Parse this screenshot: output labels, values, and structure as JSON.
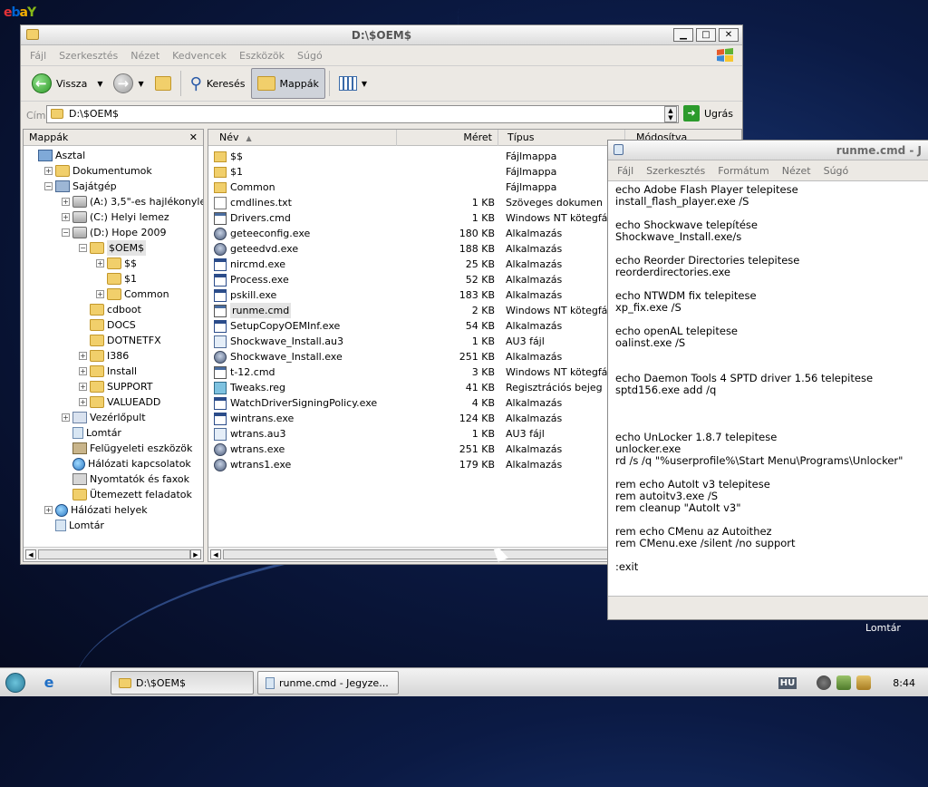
{
  "desktop": {
    "logo_letters": [
      "e",
      "b",
      "a",
      "Y"
    ],
    "icon_label": "Lomtár"
  },
  "explorer": {
    "title": "D:\\$OEM$",
    "menu": [
      "Fájl",
      "Szerkesztés",
      "Nézet",
      "Kedvencek",
      "Eszközök",
      "Súgó"
    ],
    "toolbar": {
      "back": "Vissza",
      "search": "Keresés",
      "folders": "Mappák"
    },
    "address": {
      "label": "Cím",
      "value": "D:\\$OEM$",
      "go": "Ugrás"
    },
    "folders_pane": {
      "title": "Mappák",
      "tree": [
        {
          "label": "Asztal",
          "icon": "desktop-icon",
          "level": 0,
          "expander": ""
        },
        {
          "label": "Dokumentumok",
          "icon": "folder-icon",
          "level": 1,
          "expander": "+"
        },
        {
          "label": "Sajátgép",
          "icon": "computer-icon",
          "level": 1,
          "expander": "-"
        },
        {
          "label": "(A:) 3,5\"-es hajlékonyle",
          "icon": "floppy-icon",
          "level": 2,
          "expander": "+"
        },
        {
          "label": "(C:) Helyi lemez",
          "icon": "drive-icon",
          "level": 2,
          "expander": "+"
        },
        {
          "label": "(D:) Hope 2009",
          "icon": "cd-drive-icon",
          "level": 2,
          "expander": "-"
        },
        {
          "label": "$OEM$",
          "icon": "folder-open-icon",
          "level": 3,
          "expander": "-",
          "selected": true
        },
        {
          "label": "$$",
          "icon": "folder-icon",
          "level": 4,
          "expander": "+"
        },
        {
          "label": "$1",
          "icon": "folder-icon",
          "level": 4,
          "expander": ""
        },
        {
          "label": "Common",
          "icon": "folder-icon",
          "level": 4,
          "expander": "+"
        },
        {
          "label": "cdboot",
          "icon": "folder-icon",
          "level": 3,
          "expander": ""
        },
        {
          "label": "DOCS",
          "icon": "folder-icon",
          "level": 3,
          "expander": ""
        },
        {
          "label": "DOTNETFX",
          "icon": "folder-icon",
          "level": 3,
          "expander": ""
        },
        {
          "label": "I386",
          "icon": "folder-icon",
          "level": 3,
          "expander": "+"
        },
        {
          "label": "Install",
          "icon": "folder-icon",
          "level": 3,
          "expander": "+"
        },
        {
          "label": "SUPPORT",
          "icon": "folder-icon",
          "level": 3,
          "expander": "+"
        },
        {
          "label": "VALUEADD",
          "icon": "folder-icon",
          "level": 3,
          "expander": "+"
        },
        {
          "label": "Vezérlőpult",
          "icon": "control-panel-icon",
          "level": 2,
          "expander": "+"
        },
        {
          "label": "Lomtár",
          "icon": "recycle-bin-icon",
          "level": 2,
          "expander": ""
        },
        {
          "label": "Felügyeleti eszközök",
          "icon": "tools-icon",
          "level": 2,
          "expander": ""
        },
        {
          "label": "Hálózati kapcsolatok",
          "icon": "network-icon",
          "level": 2,
          "expander": ""
        },
        {
          "label": "Nyomtatók és faxok",
          "icon": "printer-icon",
          "level": 2,
          "expander": ""
        },
        {
          "label": "Ütemezett feladatok",
          "icon": "folder-icon",
          "level": 2,
          "expander": ""
        },
        {
          "label": "Hálózati helyek",
          "icon": "network-icon",
          "level": 1,
          "expander": "+"
        },
        {
          "label": "Lomtár",
          "icon": "recycle-bin-icon",
          "level": 1,
          "expander": ""
        }
      ]
    },
    "file_list": {
      "columns": [
        "Név",
        "Méret",
        "Típus",
        "Módosítva"
      ],
      "rows": [
        {
          "name": "$$",
          "size": "",
          "type": "Fájlmappa",
          "icon": "folder"
        },
        {
          "name": "$1",
          "size": "",
          "type": "Fájlmappa",
          "icon": "folder"
        },
        {
          "name": "Common",
          "size": "",
          "type": "Fájlmappa",
          "icon": "folder"
        },
        {
          "name": "cmdlines.txt",
          "size": "1 KB",
          "type": "Szöveges dokumen",
          "icon": "txt"
        },
        {
          "name": "Drivers.cmd",
          "size": "1 KB",
          "type": "Windows NT kötegfá",
          "icon": "cmd"
        },
        {
          "name": "geteeconfig.exe",
          "size": "180 KB",
          "type": "Alkalmazás",
          "icon": "app"
        },
        {
          "name": "geteedvd.exe",
          "size": "188 KB",
          "type": "Alkalmazás",
          "icon": "app"
        },
        {
          "name": "nircmd.exe",
          "size": "25 KB",
          "type": "Alkalmazás",
          "icon": "exe"
        },
        {
          "name": "Process.exe",
          "size": "52 KB",
          "type": "Alkalmazás",
          "icon": "exe"
        },
        {
          "name": "pskill.exe",
          "size": "183 KB",
          "type": "Alkalmazás",
          "icon": "exe"
        },
        {
          "name": "runme.cmd",
          "size": "2 KB",
          "type": "Windows NT kötegfá",
          "icon": "cmd",
          "selected": true
        },
        {
          "name": "SetupCopyOEMInf.exe",
          "size": "54 KB",
          "type": "Alkalmazás",
          "icon": "exe"
        },
        {
          "name": "Shockwave_Install.au3",
          "size": "1 KB",
          "type": "AU3 fájl",
          "icon": "au3"
        },
        {
          "name": "Shockwave_Install.exe",
          "size": "251 KB",
          "type": "Alkalmazás",
          "icon": "app"
        },
        {
          "name": "t-12.cmd",
          "size": "3 KB",
          "type": "Windows NT kötegfá",
          "icon": "cmd"
        },
        {
          "name": "Tweaks.reg",
          "size": "41 KB",
          "type": "Regisztrációs bejeg",
          "icon": "reg"
        },
        {
          "name": "WatchDriverSigningPolicy.exe",
          "size": "4 KB",
          "type": "Alkalmazás",
          "icon": "exe"
        },
        {
          "name": "wintrans.exe",
          "size": "124 KB",
          "type": "Alkalmazás",
          "icon": "exe"
        },
        {
          "name": "wtrans.au3",
          "size": "1 KB",
          "type": "AU3 fájl",
          "icon": "au3"
        },
        {
          "name": "wtrans.exe",
          "size": "251 KB",
          "type": "Alkalmazás",
          "icon": "app"
        },
        {
          "name": "wtrans1.exe",
          "size": "179 KB",
          "type": "Alkalmazás",
          "icon": "app"
        }
      ]
    }
  },
  "notepad": {
    "title": "runme.cmd - J",
    "menu": [
      "Fájl",
      "Szerkesztés",
      "Formátum",
      "Nézet",
      "Súgó"
    ],
    "content": "echo Adobe Flash Player telepitese\ninstall_flash_player.exe /S\n\necho Shockwave telepítése\nShockwave_Install.exe/s\n\necho Reorder Directories telepitese\nreorderdirectories.exe\n\necho NTWDM fix telepitese\nxp_fix.exe /S\n\necho openAL telepitese\noalinst.exe /S\n\n\necho Daemon Tools 4 SPTD driver 1.56 telepitese\nsptd156.exe add /q\n\n\n\necho UnLocker 1.8.7 telepitese\nunlocker.exe\nrd /s /q \"%userprofile%\\Start Menu\\Programs\\Unlocker\"\n\nrem echo AutoIt v3 telepitese\nrem autoitv3.exe /S\nrem cleanup \"AutoIt v3\"\n\nrem echo CMenu az Autoithez\nrem CMenu.exe /silent /no support\n\n:exit"
  },
  "taskbar": {
    "buttons": [
      {
        "label": "D:\\$OEM$",
        "icon": "folder-icon"
      },
      {
        "label": "runme.cmd - Jegyze...",
        "icon": "notepad-icon"
      }
    ],
    "tray": {
      "lang": "HU",
      "clock": "8:44"
    }
  }
}
